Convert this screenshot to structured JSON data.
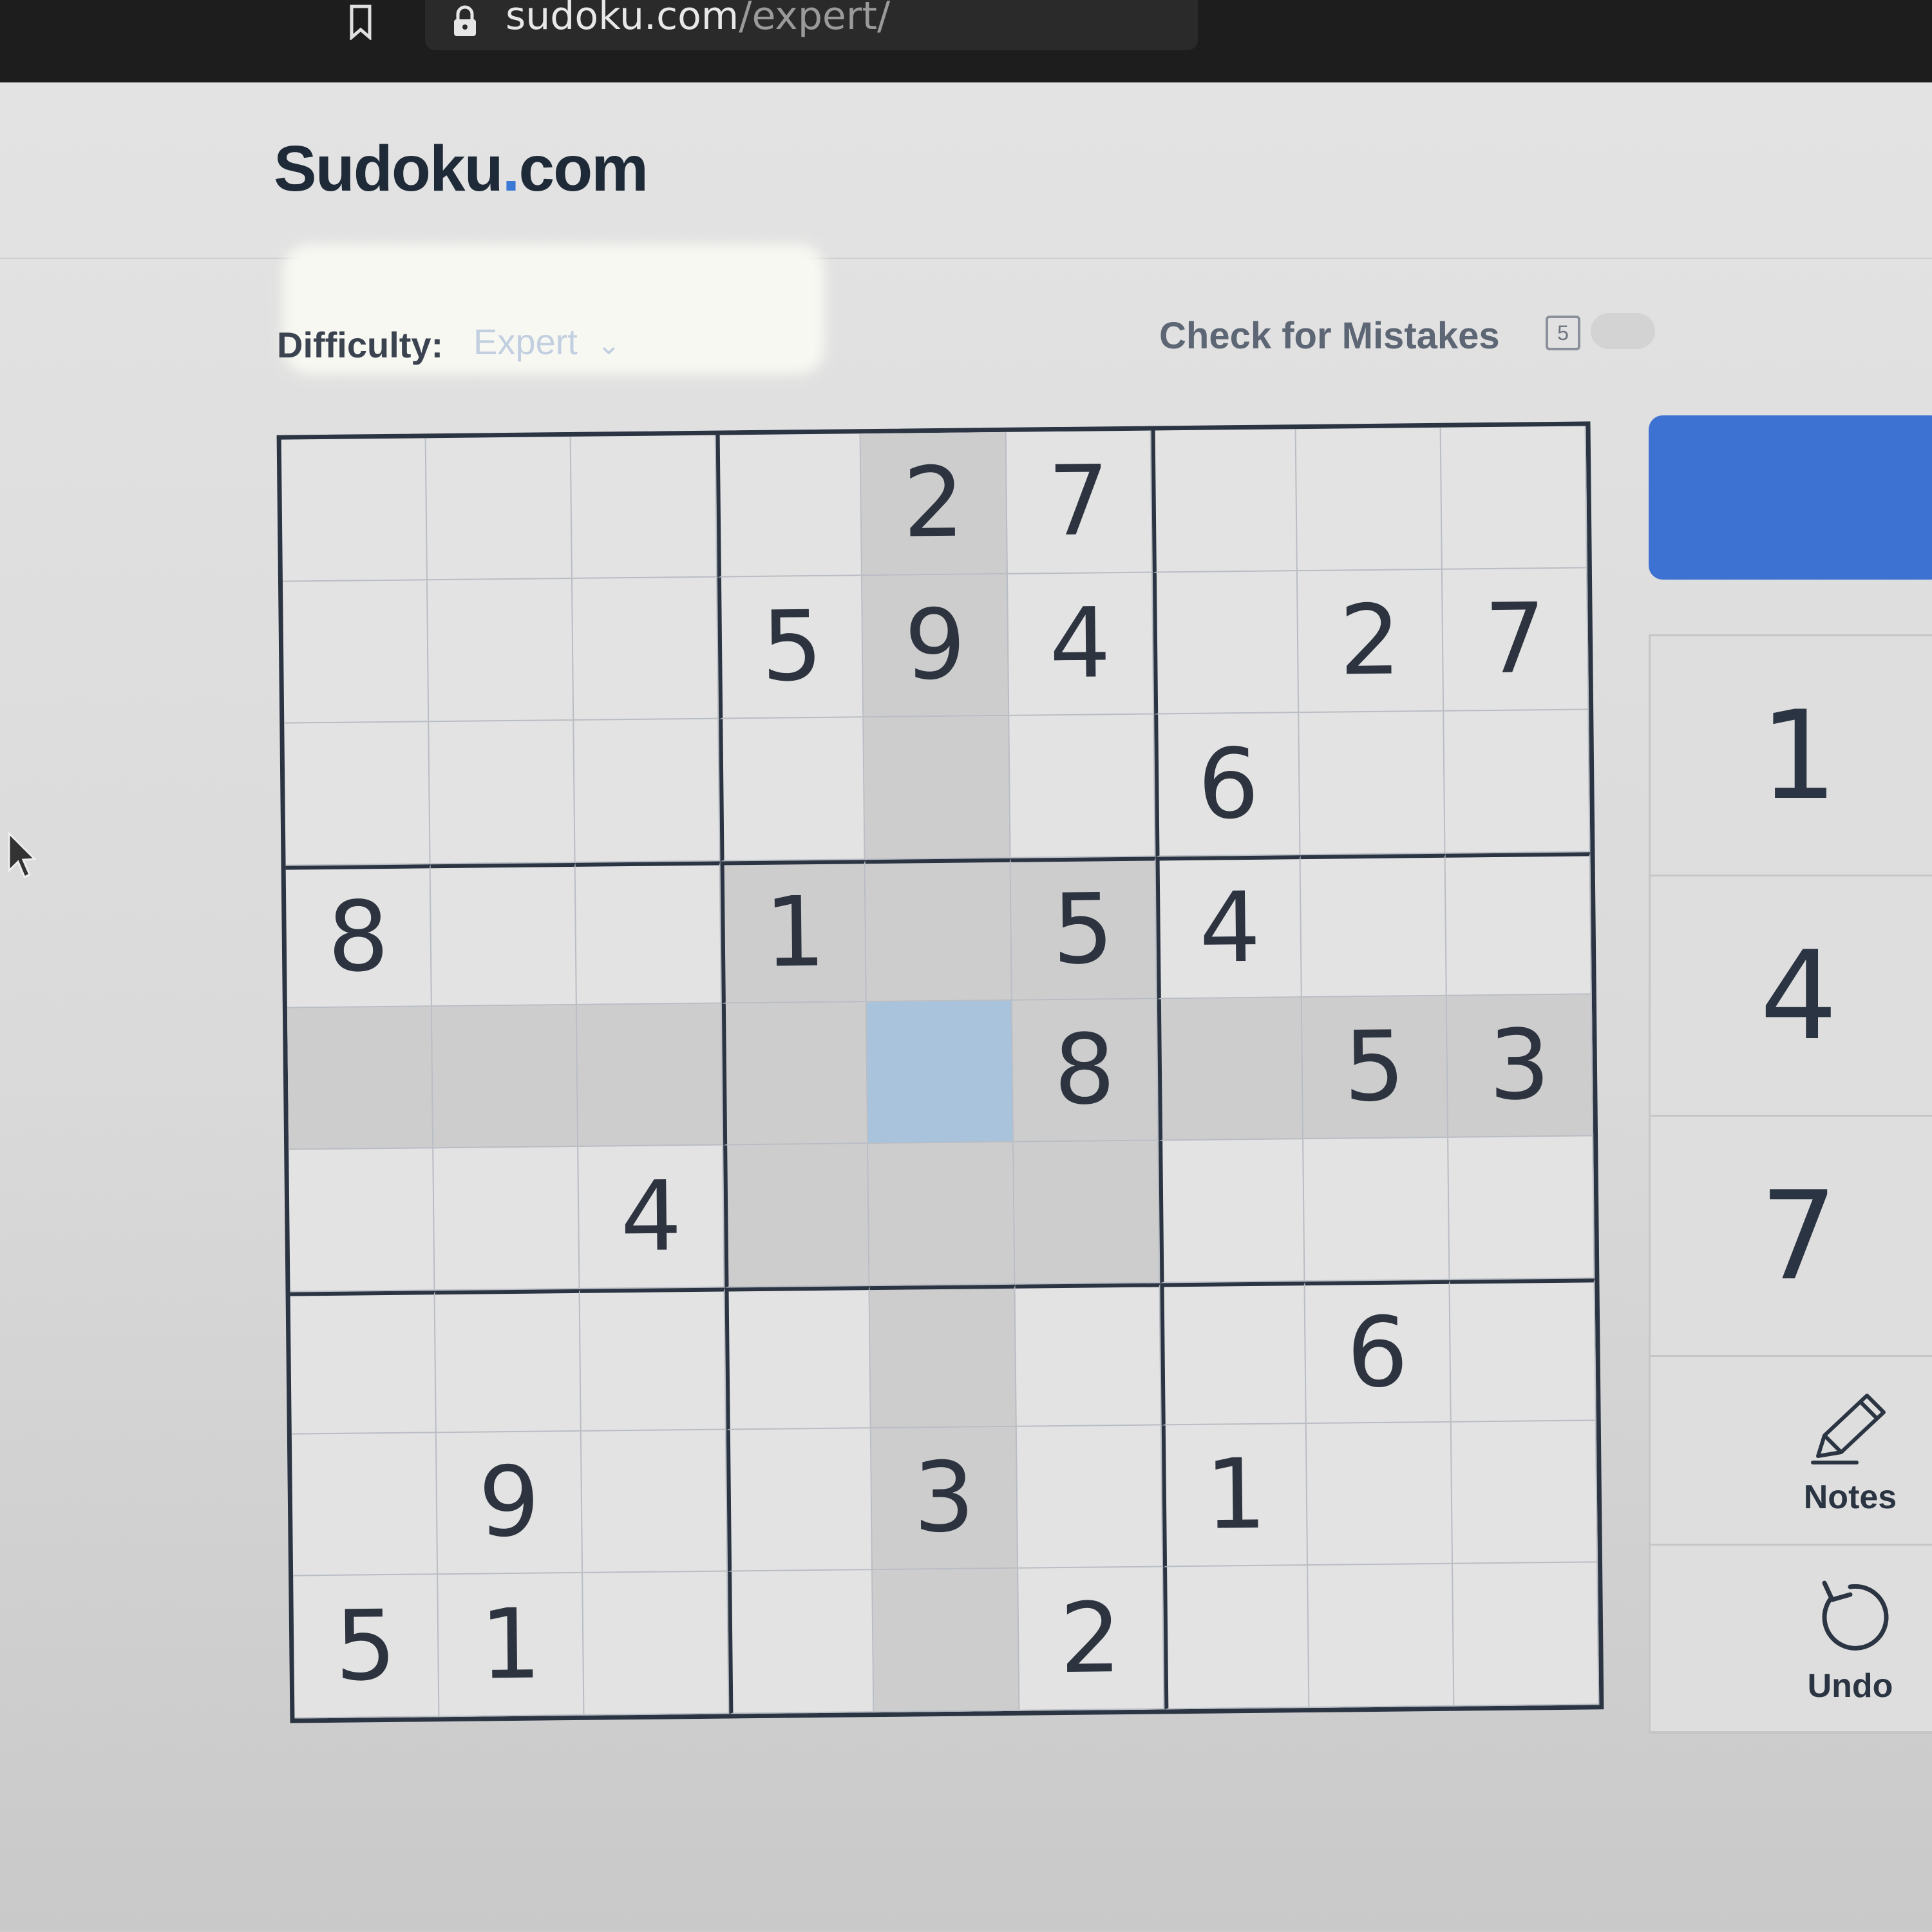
{
  "browser": {
    "url_host": "sudoku.com",
    "url_path": "/expert/"
  },
  "header": {
    "logo_text": "Sudoku",
    "logo_dot": ".",
    "logo_suffix": "com"
  },
  "controls": {
    "difficulty_label": "Difficulty:",
    "difficulty_value": "Expert",
    "difficulty_chevron": "⌄",
    "check_mistakes_label": "Check for Mistakes",
    "mistakes_badge": "5"
  },
  "board": {
    "rows": [
      [
        "",
        "",
        "",
        "",
        "2",
        "7",
        "",
        "",
        ""
      ],
      [
        "",
        "",
        "",
        "5",
        "9",
        "4",
        "",
        "2",
        "7"
      ],
      [
        "",
        "",
        "",
        "",
        "",
        "",
        "6",
        "",
        ""
      ],
      [
        "8",
        "",
        "",
        "1",
        "",
        "5",
        "4",
        "",
        ""
      ],
      [
        "",
        "",
        "",
        "",
        "",
        "8",
        "",
        "5",
        "3"
      ],
      [
        "",
        "",
        "4",
        "",
        "",
        "",
        "",
        "",
        ""
      ],
      [
        "",
        "",
        "",
        "",
        "",
        "",
        "",
        "6",
        ""
      ],
      [
        "",
        "9",
        "",
        "",
        "3",
        "",
        "1",
        "",
        ""
      ],
      [
        "5",
        "1",
        "",
        "",
        "",
        "2",
        "",
        "",
        ""
      ]
    ],
    "selected_cell": [
      4,
      4
    ],
    "highlight_color": "#cdcdcd",
    "selected_color": "#a9c3dd"
  },
  "numpad": {
    "keys": [
      "1",
      "4",
      "7"
    ]
  },
  "tools": {
    "notes_label": "Notes",
    "undo_label": "Undo"
  },
  "colors": {
    "accent": "#3d72d3",
    "logo_dot": "#3a78d6",
    "grid_line": "#2b3442"
  }
}
